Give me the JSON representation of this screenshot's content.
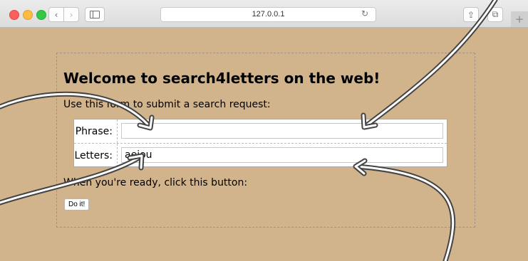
{
  "browser": {
    "url": "127.0.0.1",
    "icons": {
      "back": "chevron-left-icon",
      "forward": "chevron-right-icon",
      "sidebar": "sidebar-icon",
      "reload": "reload-icon",
      "share": "share-icon",
      "tabs": "tabs-icon",
      "new_tab": "plus-icon"
    },
    "glyphs": {
      "back": "‹",
      "forward": "›",
      "reload": "↻",
      "share": "⇪",
      "tabs": "⧉",
      "new_tab": "+"
    }
  },
  "page": {
    "background_color": "#d2b48c",
    "heading": "Welcome to search4letters on the web!",
    "intro": "Use this form to submit a search request:",
    "form": {
      "phrase_label": "Phrase:",
      "phrase_value": "",
      "letters_label": "Letters:",
      "letters_value": "aeiou"
    },
    "prompt": "When you're ready, click this button:",
    "submit_label": "Do it!"
  }
}
